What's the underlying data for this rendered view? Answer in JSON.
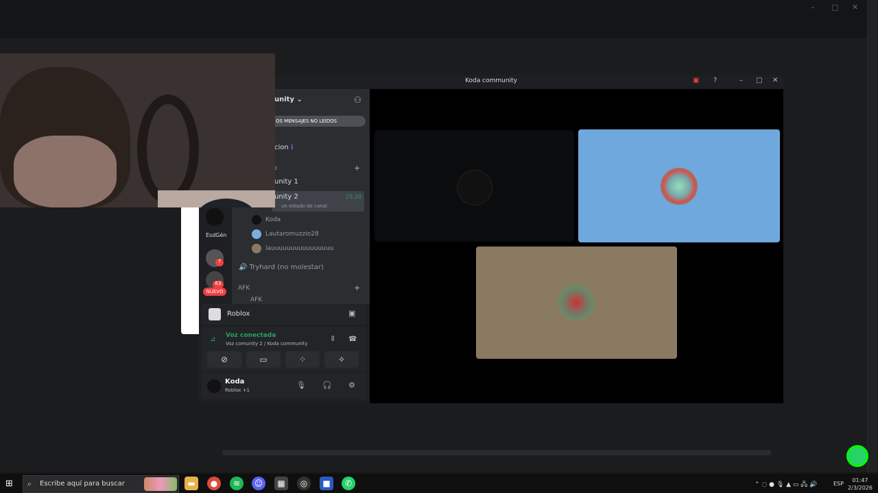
{
  "discord": {
    "title": "Koda community",
    "server_name": "unity",
    "unread_banner": "OS MENSAJES NO LEÍDOS",
    "channels": {
      "announcement": "cion",
      "category_partial": "z",
      "voice1": "unity 1",
      "voice2": "unity 2",
      "voice2_timer": "25:20",
      "status_line": "un estado de canal",
      "members": [
        "Koda",
        "Lautaromuzzio28",
        "lauuuuuuuuuuuuuuuu"
      ],
      "tryhard": "Tryhard (no molestar)",
      "afk_category": "AFK",
      "afk_channel": "AFK"
    },
    "servers": {
      "label1": "EsdGén",
      "badge1": "7",
      "badge2": "63",
      "nuevo": "NUEVO"
    },
    "activity": {
      "name": "Roblox"
    },
    "voice": {
      "status": "Voz conectada",
      "detail": "Voz comunity 2 / Koda community"
    },
    "user": {
      "name": "Koda",
      "activity": "Roblox +1"
    }
  },
  "taskbar": {
    "search_placeholder": "Escribe aquí para buscar",
    "lang": "ESP",
    "time": "01:47",
    "date": "2/3/2026"
  },
  "icons": [
    "windows-icon",
    "search-icon",
    "file-explorer-icon",
    "chrome-icon",
    "spotify-icon",
    "discord-icon",
    "store-icon",
    "steam-icon",
    "app-icon",
    "whatsapp-icon"
  ],
  "colors": {
    "discord_green": "#23a55a",
    "tile_blue": "#6fa8dc",
    "tile_tan": "#8a7a62"
  }
}
